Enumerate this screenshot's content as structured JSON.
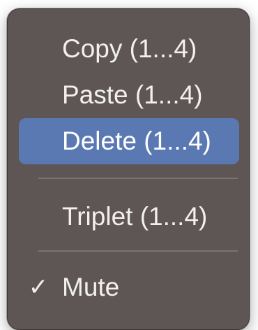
{
  "menu": {
    "items": [
      {
        "label": "Copy (1...4)",
        "highlighted": false
      },
      {
        "label": "Paste (1...4)",
        "highlighted": false
      },
      {
        "label": "Delete (1...4)",
        "highlighted": true
      },
      {
        "label": "Triplet (1...4)",
        "highlighted": false
      },
      {
        "label": "Mute",
        "checked": true,
        "check_glyph": "✓"
      }
    ]
  },
  "colors": {
    "menu_background": "#5e5654",
    "highlight": "#5a79b3",
    "text": "#f2f0ef",
    "separator": "#7a7371"
  }
}
